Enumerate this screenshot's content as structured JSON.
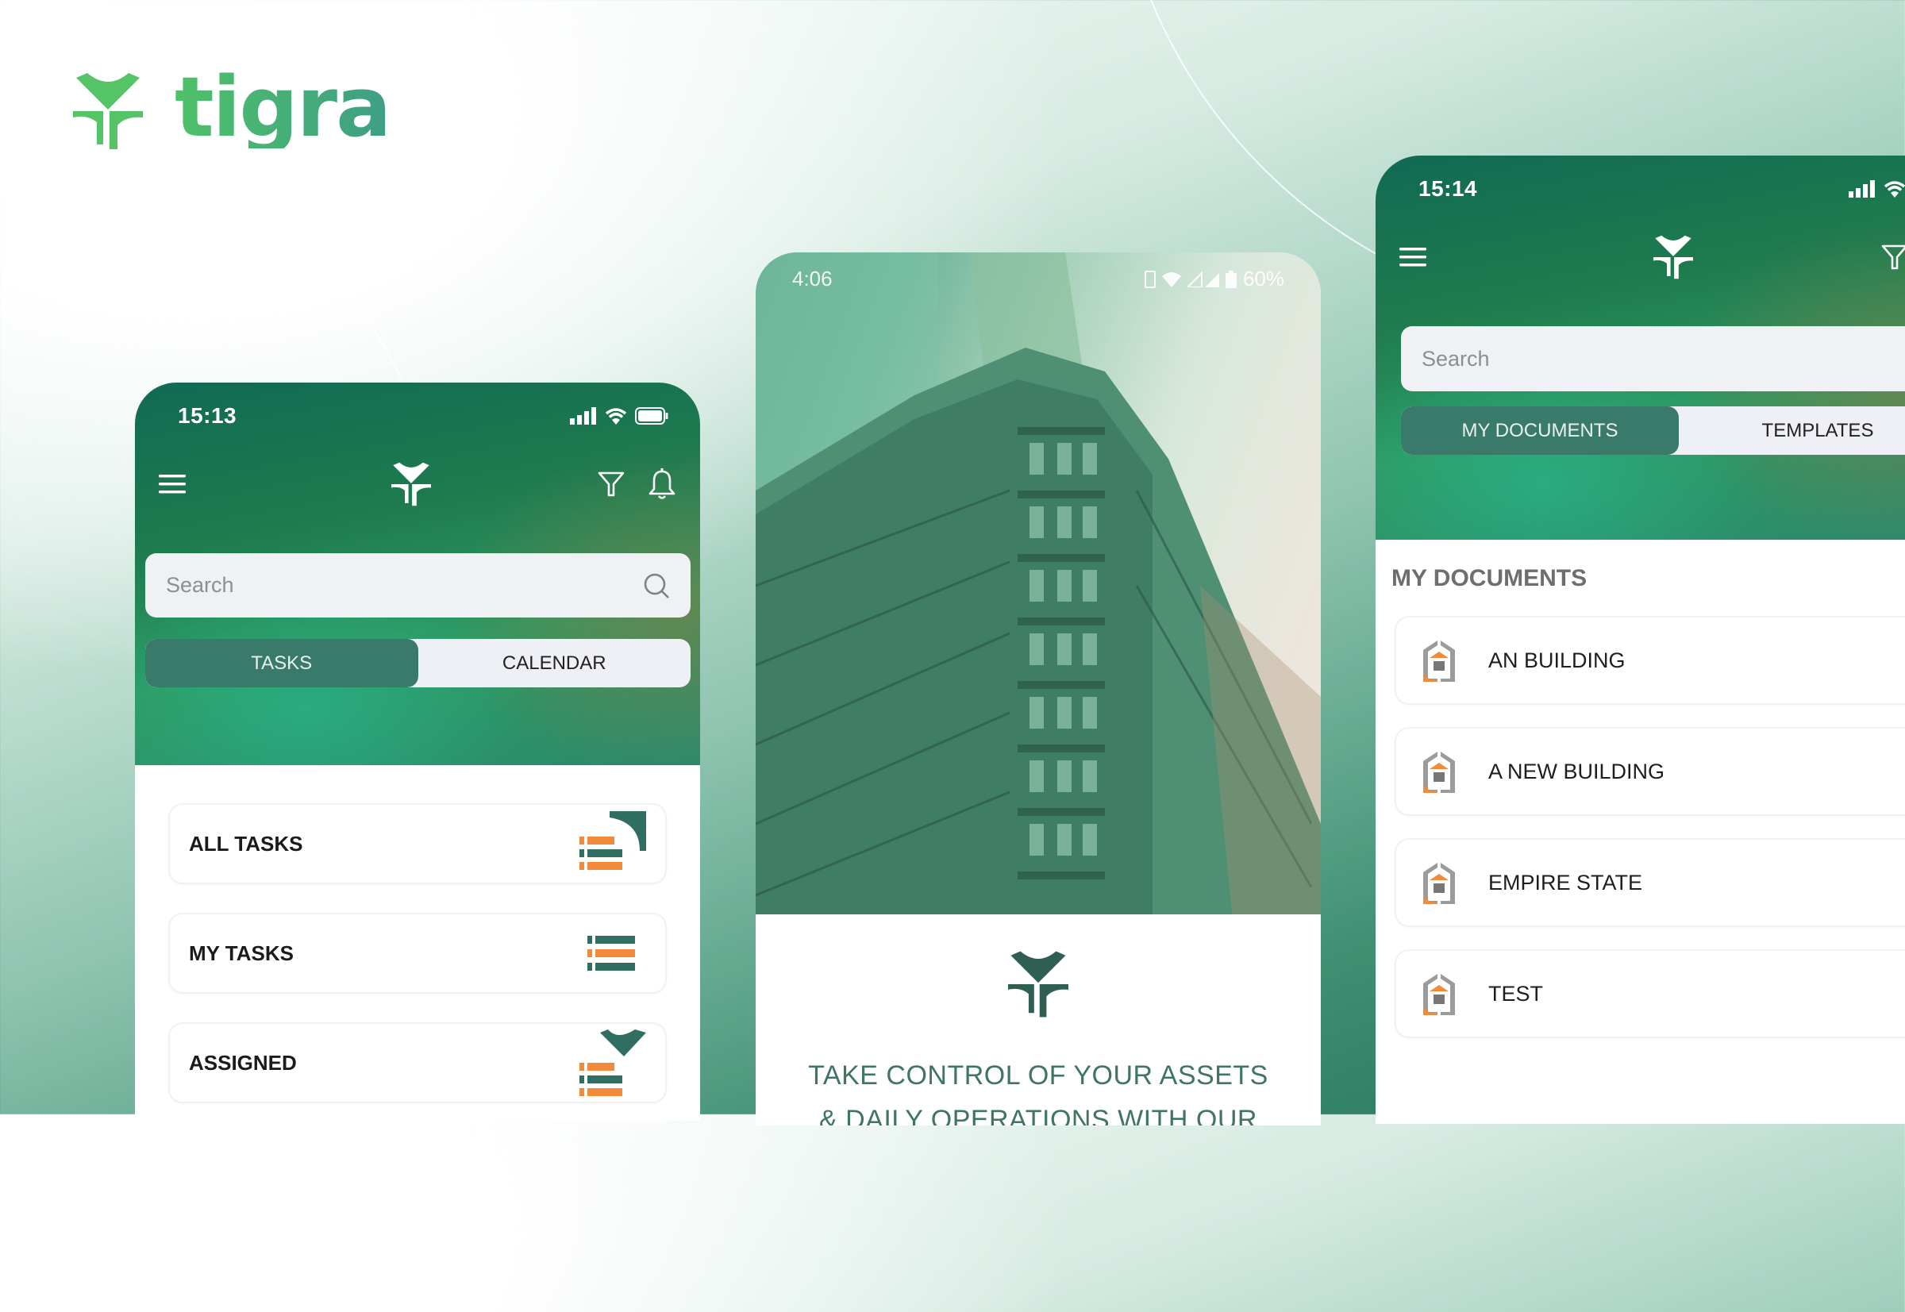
{
  "brand": {
    "name": "tigra",
    "colors": {
      "primary_green": "#4fc169",
      "dark_teal": "#2f5e52",
      "accent_orange": "#f28a3c",
      "tab_active": "#3a7a6a"
    }
  },
  "phone_tasks": {
    "status": {
      "time": "15:13"
    },
    "search": {
      "placeholder": "Search"
    },
    "tabs": [
      {
        "label": "TASKS",
        "active": true
      },
      {
        "label": "CALENDAR",
        "active": false
      }
    ],
    "cards": [
      {
        "label": "ALL TASKS",
        "icon": "all-tasks-icon"
      },
      {
        "label": "MY TASKS",
        "icon": "my-tasks-icon"
      },
      {
        "label": "ASSIGNED",
        "icon": "assigned-icon"
      }
    ]
  },
  "phone_splash": {
    "status": {
      "time": "4:06",
      "battery": "60%"
    },
    "tagline_line1": "TAKE CONTROL OF YOUR ASSETS",
    "tagline_line2": "& DAILY OPERATIONS WITH OUR"
  },
  "phone_documents": {
    "status": {
      "time": "15:14"
    },
    "search": {
      "placeholder": "Search"
    },
    "tabs": [
      {
        "label": "MY DOCUMENTS",
        "active": true
      },
      {
        "label": "TEMPLATES",
        "active": false
      }
    ],
    "section_title": "MY DOCUMENTS",
    "documents": [
      {
        "name": "AN BUILDING",
        "more": "•••"
      },
      {
        "name": "A NEW BUILDING",
        "more": "•••"
      },
      {
        "name": "EMPIRE STATE",
        "more": "•••"
      },
      {
        "name": "TEST",
        "more": "•••"
      }
    ]
  }
}
